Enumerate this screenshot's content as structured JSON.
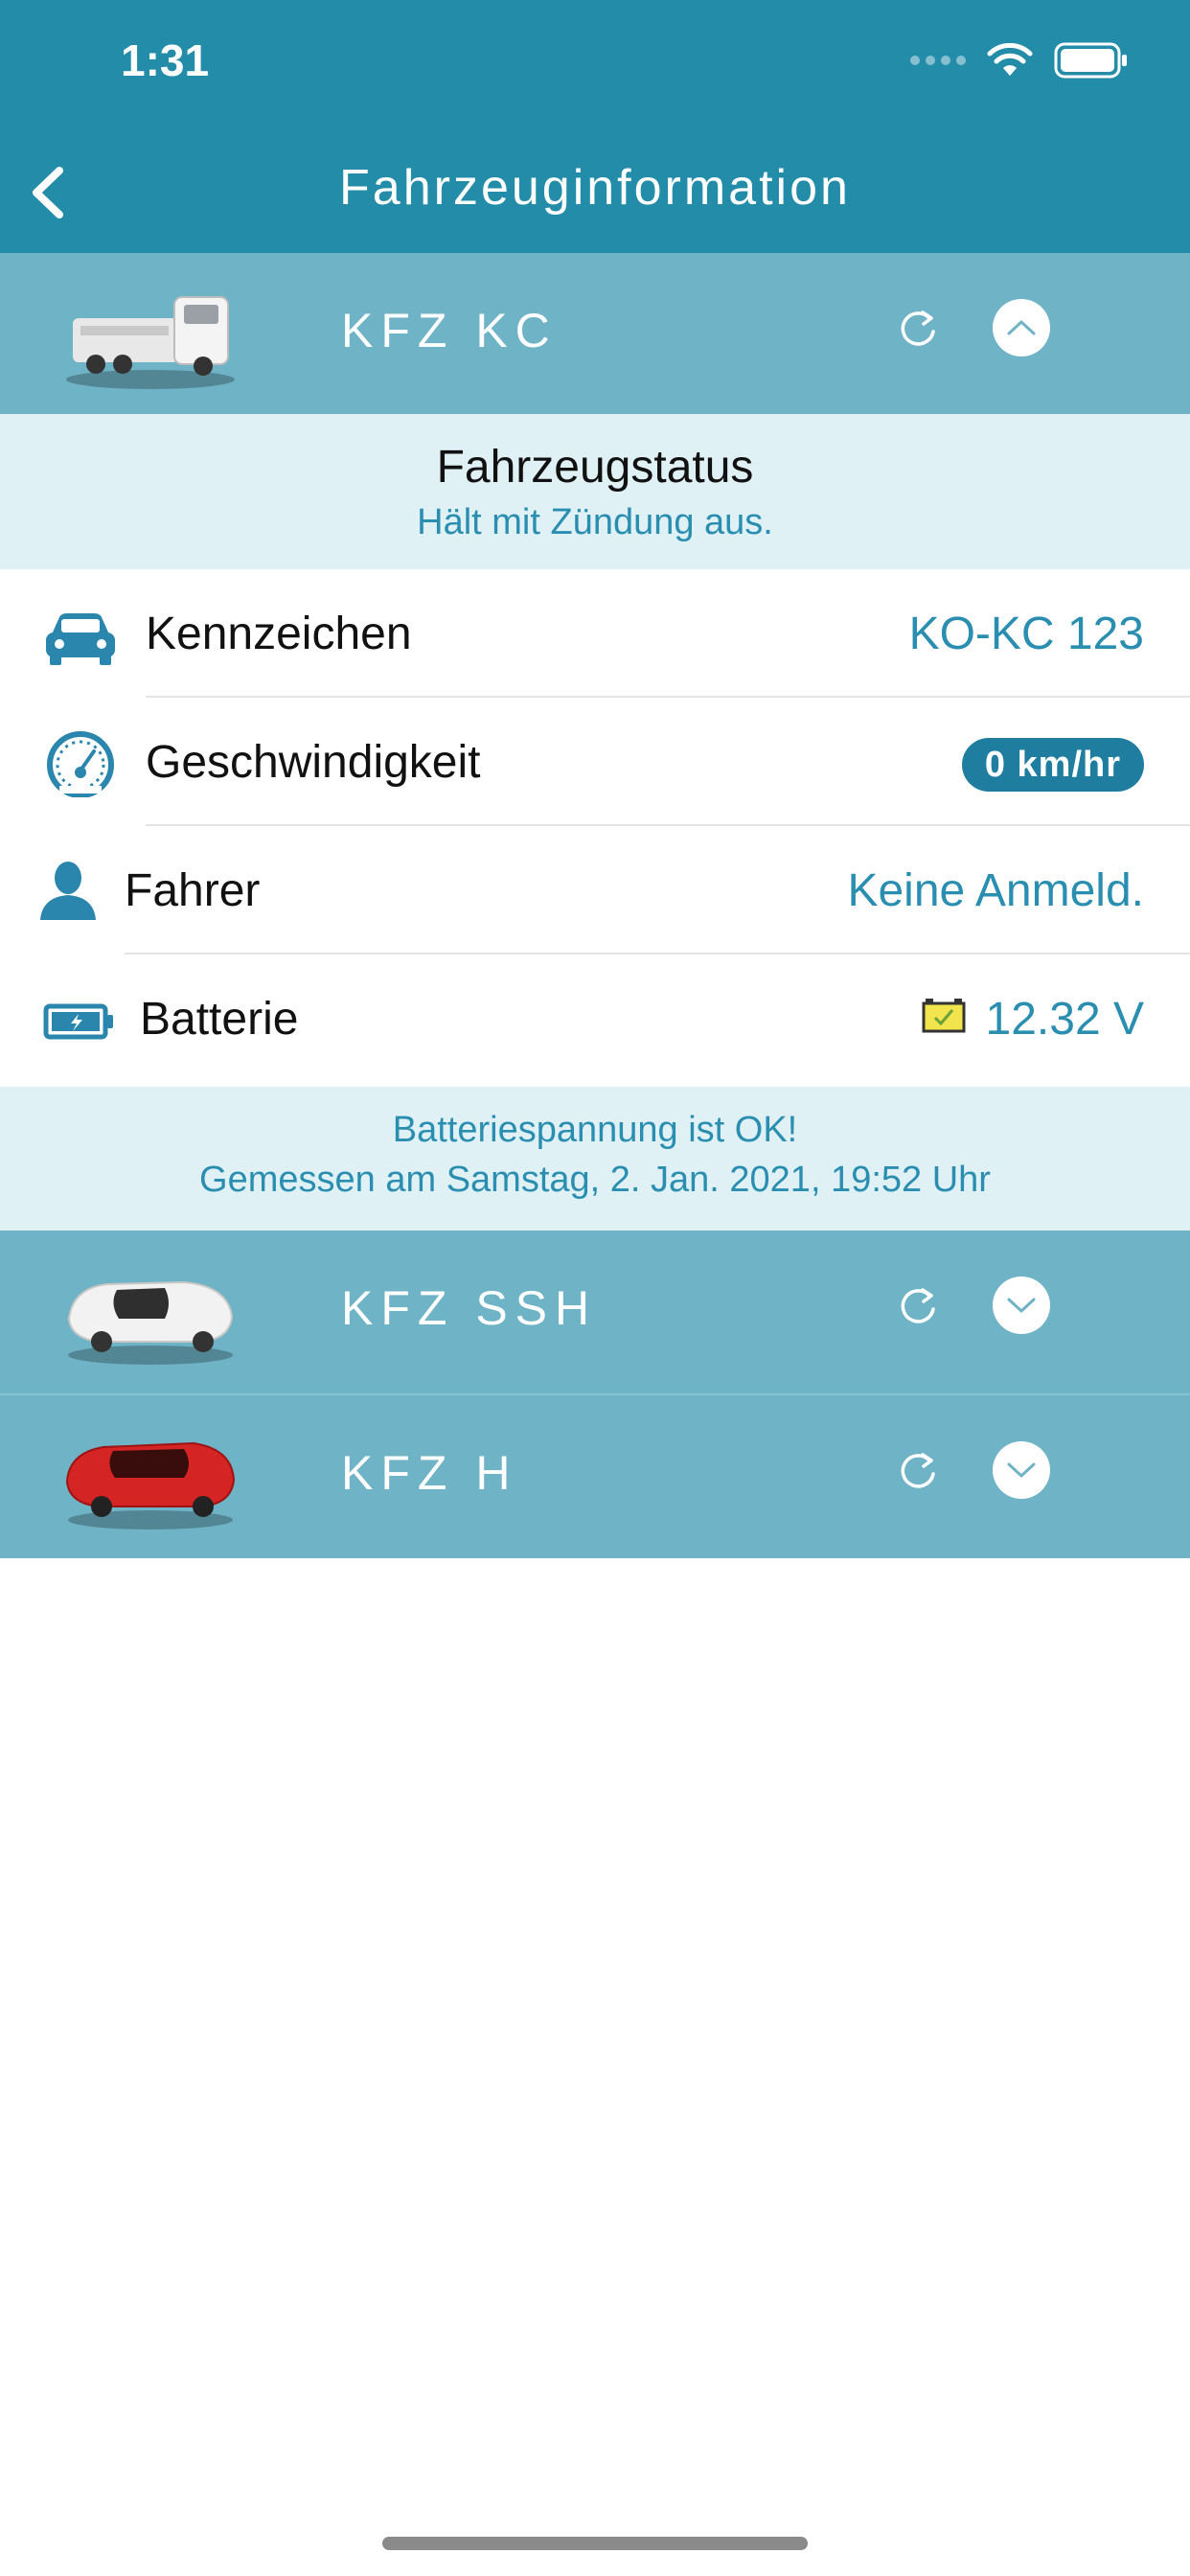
{
  "status_bar": {
    "time": "1:31"
  },
  "nav": {
    "title": "Fahrzeuginformation",
    "back_icon": "chevron-left-icon"
  },
  "vehicles": [
    {
      "name": "KFZ KC",
      "expanded": true
    },
    {
      "name": "KFZ SSH",
      "expanded": false
    },
    {
      "name": "KFZ H",
      "expanded": false
    }
  ],
  "status": {
    "title": "Fahrzeugstatus",
    "subtitle": "Hält mit Zündung aus."
  },
  "rows": {
    "plate": {
      "label": "Kennzeichen",
      "value": "KO-KC 123",
      "icon": "car-icon"
    },
    "speed": {
      "label": "Geschwindigkeit",
      "value": "0 km/hr",
      "icon": "speedometer-icon"
    },
    "driver": {
      "label": "Fahrer",
      "value": "Keine Anmeld.",
      "icon": "person-icon"
    },
    "battery": {
      "label": "Batterie",
      "value": "12.32 V",
      "icon": "battery-icon"
    }
  },
  "battery_info": {
    "line1": "Batteriespannung ist OK!",
    "line2": "Gemessen am Samstag, 2. Jan. 2021, 19:52 Uhr"
  },
  "colors": {
    "accent": "#238ca8",
    "header": "#6fb3c6",
    "panel": "#e0f1f6",
    "value_text": "#2a8eb0",
    "pill": "#1f7da0"
  }
}
